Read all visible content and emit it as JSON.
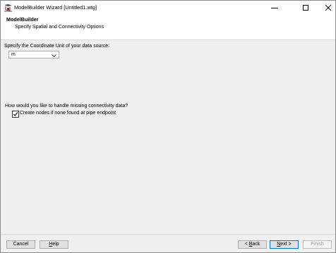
{
  "window": {
    "title": "ModelBuilder Wizard [Untitled1.wtg]"
  },
  "header": {
    "title": "ModelBuilder",
    "subtitle": "Specify Spatial and Connectivity Options"
  },
  "spatial": {
    "coord_label": "Specify the Coordinate Unit of your data source:",
    "coord_unit_selected": "m"
  },
  "connectivity": {
    "question": "How would you like to handle missing connectivity data?",
    "create_nodes_label": "Create nodes if none found at pipe endpoint",
    "create_nodes_checked": true
  },
  "footer": {
    "cancel": "Cancel",
    "help_first": "H",
    "help_rest": "elp",
    "back_prefix": "< ",
    "back_first": "B",
    "back_rest": "ack",
    "next_first": "N",
    "next_rest": "ext >",
    "finish": "Finish"
  },
  "colors": {
    "accent": "#0078d7",
    "window_bg": "#f0f0f0",
    "button_bg": "#e1e1e1"
  },
  "icons": {
    "app": "modelbuilder-wizard-icon",
    "minimize": "minimize-icon",
    "maximize": "maximize-icon",
    "close": "close-icon",
    "dropdown": "chevron-down-icon",
    "check": "check-icon"
  }
}
